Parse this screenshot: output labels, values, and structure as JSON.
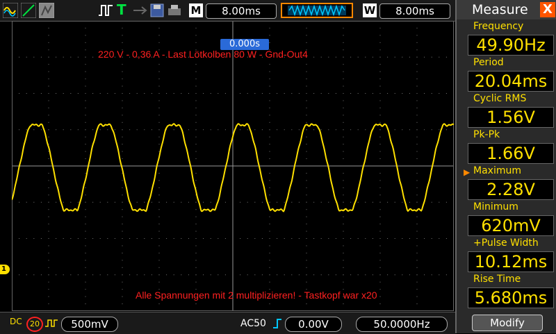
{
  "toolbar": {
    "m_letter": "M",
    "main_timebase": "8.00ms",
    "w_letter": "W",
    "window_timebase": "8.00ms",
    "trigger_t": "T"
  },
  "screen": {
    "trigger_time": "0.000s",
    "annotation_top": "220 V - 0,36 A - Last Lötkolben 80 W - Gnd-Out4",
    "annotation_bottom": "Alle Spannungen mit 2 multiplizieren! - Tastkopf war x20",
    "ch1_marker": "1"
  },
  "status": {
    "coupling": "DC",
    "bw_limit": "20",
    "volts_div": "500mV",
    "trigger_mode": "AC50",
    "trigger_level": "0.00V",
    "trigger_freq": "50.0000Hz"
  },
  "measure": {
    "title": "Measure",
    "close": "X",
    "items": [
      {
        "label": "Frequency",
        "value": "49.90Hz"
      },
      {
        "label": "Period",
        "value": "20.04ms"
      },
      {
        "label": "Cyclic RMS",
        "value": "1.56V"
      },
      {
        "label": "Pk-Pk",
        "value": "1.66V"
      },
      {
        "label": "Maximum",
        "value": "2.28V"
      },
      {
        "label": "Minimum",
        "value": "620mV"
      },
      {
        "label": "+Pulse Width",
        "value": "10.12ms"
      },
      {
        "label": "Rise Time",
        "value": "5.680ms"
      }
    ],
    "modify_label": "Modify"
  },
  "colors": {
    "trace": "#ffe000",
    "annotation": "#ff2020",
    "accent": "#ff5500"
  }
}
